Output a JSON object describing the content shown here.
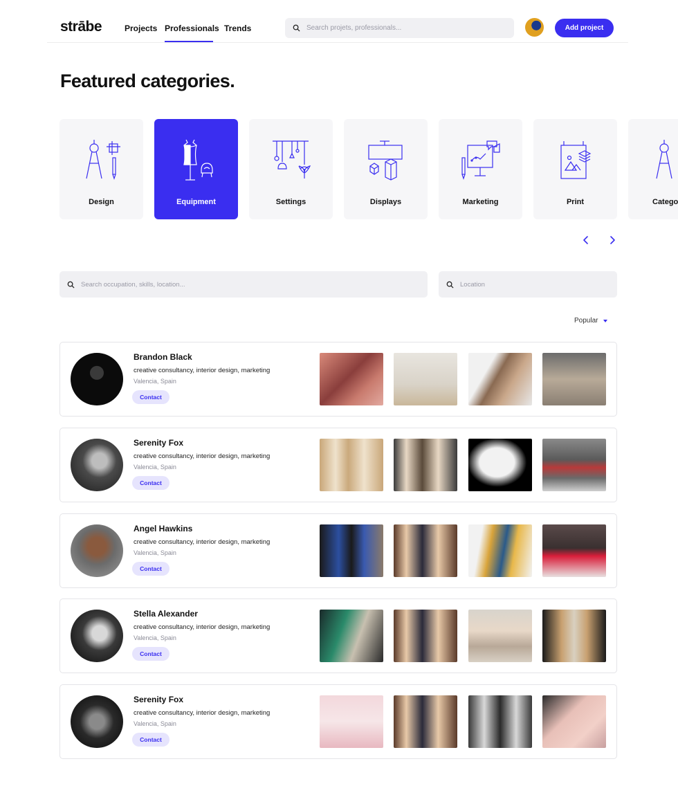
{
  "brand": {
    "logo": "strābe"
  },
  "nav": [
    {
      "label": "Projects"
    },
    {
      "label": "Professionals"
    },
    {
      "label": "Trends"
    }
  ],
  "top_search": {
    "placeholder": "Search projets, professionals..."
  },
  "header": {
    "add_button": "Add project"
  },
  "page_title": "Featured categories.",
  "categories": [
    {
      "label": "Design",
      "icon": "compass-icon",
      "active": false
    },
    {
      "label": "Equipment",
      "icon": "mannequin-icon",
      "active": true
    },
    {
      "label": "Settings",
      "icon": "hanging-lamps-icon",
      "active": false
    },
    {
      "label": "Displays",
      "icon": "display-stand-icon",
      "active": false
    },
    {
      "label": "Marketing",
      "icon": "presentation-board-icon",
      "active": false
    },
    {
      "label": "Print",
      "icon": "print-board-icon",
      "active": false
    },
    {
      "label": "Catego",
      "icon": "compass-icon",
      "active": false
    }
  ],
  "filters": {
    "occupation_placeholder": "Search occupation, skills, location...",
    "location_placeholder": "Location",
    "sort_label": "Popular"
  },
  "professionals": [
    {
      "name": "Brandon Black",
      "skills": "creative consultancy, interior design, marketing",
      "location": "Valencia, Spain",
      "contact": "Contact"
    },
    {
      "name": "Serenity Fox",
      "skills": "creative consultancy, interior design, marketing",
      "location": "Valencia, Spain",
      "contact": "Contact"
    },
    {
      "name": "Angel Hawkins",
      "skills": "creative consultancy, interior design, marketing",
      "location": "Valencia, Spain",
      "contact": "Contact"
    },
    {
      "name": "Stella Alexander",
      "skills": "creative consultancy, interior design, marketing",
      "location": "Valencia, Spain",
      "contact": "Contact"
    },
    {
      "name": "Serenity Fox",
      "skills": "creative consultancy, interior design, marketing",
      "location": "Valencia, Spain",
      "contact": "Contact"
    }
  ],
  "colors": {
    "accent": "#3a2ef0",
    "card_bg": "#f6f6f8",
    "contact_bg": "#e6e4fd"
  }
}
